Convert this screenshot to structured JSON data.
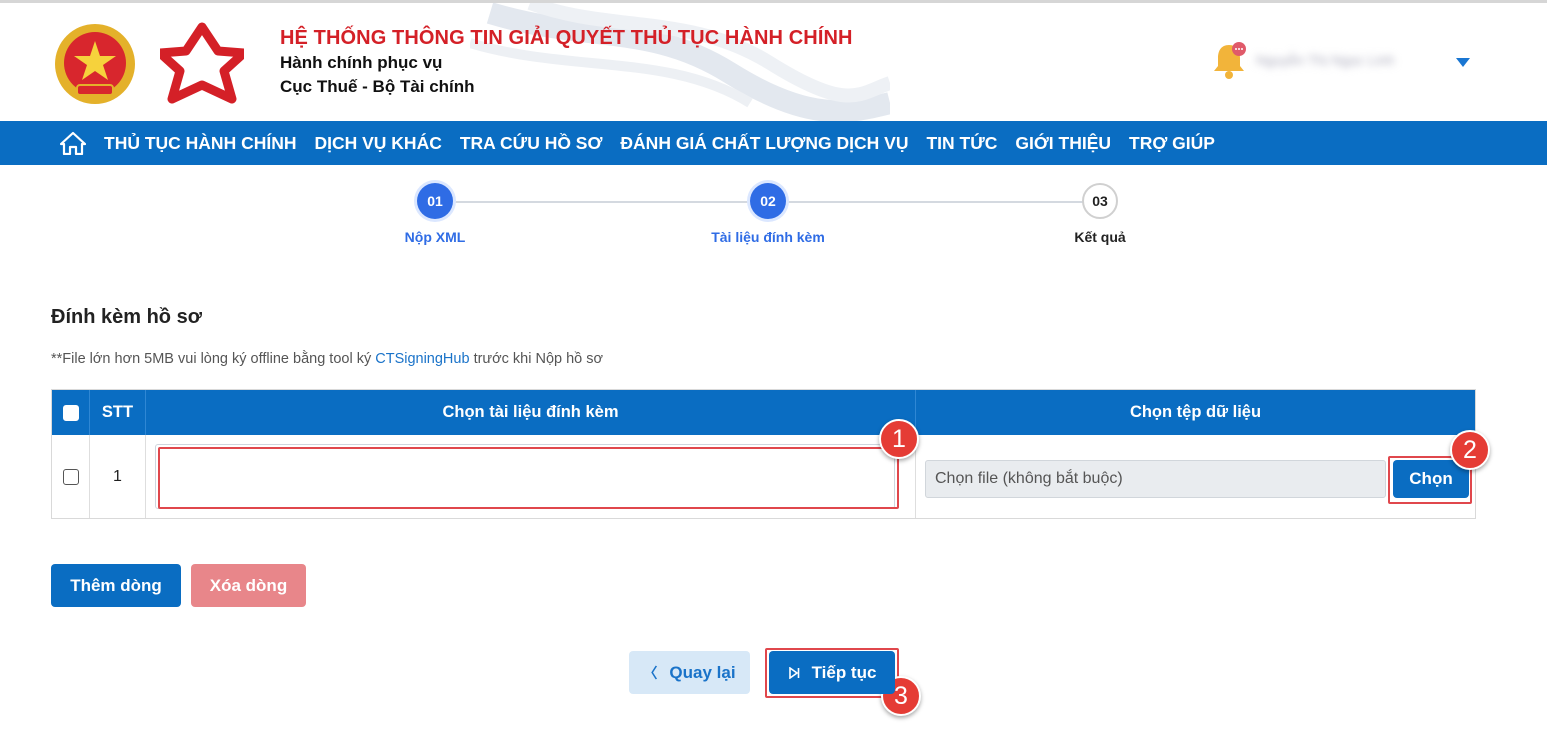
{
  "header": {
    "title": "HỆ THỐNG THÔNG TIN GIẢI QUYẾT THỦ TỤC HÀNH CHÍNH",
    "subtitle1": "Hành chính phục vụ",
    "subtitle2": "Cục Thuế - Bộ Tài chính",
    "user_name": "Nguyễn Thị Ngọc Linh"
  },
  "nav": {
    "items": [
      {
        "label": "THỦ TỤC HÀNH CHÍNH"
      },
      {
        "label": "DỊCH VỤ KHÁC"
      },
      {
        "label": "TRA CỨU HỒ SƠ"
      },
      {
        "label": "ĐÁNH GIÁ CHẤT LƯỢNG DỊCH VỤ"
      },
      {
        "label": "TIN TỨC"
      },
      {
        "label": "GIỚI THIỆU"
      },
      {
        "label": "TRỢ GIÚP"
      }
    ]
  },
  "stepper": {
    "steps": [
      {
        "number": "01",
        "label": "Nộp XML",
        "state": "active"
      },
      {
        "number": "02",
        "label": "Tài liệu đính kèm",
        "state": "active"
      },
      {
        "number": "03",
        "label": "Kết quả",
        "state": "pending"
      }
    ]
  },
  "section": {
    "title": "Đính kèm hồ sơ",
    "note_prefix": "**File lớn hơn 5MB vui lòng ký offline bằng tool ký ",
    "note_link": "CTSigningHub",
    "note_suffix": " trước khi Nộp hồ sơ"
  },
  "table": {
    "headers": {
      "stt": "STT",
      "document": "Chọn tài liệu đính kèm",
      "file": "Chọn tệp dữ liệu"
    },
    "rows": [
      {
        "stt": "1",
        "document": "",
        "file_placeholder": "Chọn file (không bắt buộc)",
        "choose_label": "Chọn"
      }
    ]
  },
  "actions": {
    "add_row": "Thêm dòng",
    "delete_row": "Xóa dòng",
    "back": "Quay lại",
    "next": "Tiếp tục"
  },
  "annotations": [
    "1",
    "2",
    "3"
  ],
  "colors": {
    "primary": "#0a6dc2",
    "title_red": "#d42027",
    "step_active": "#2f6ce5",
    "highlight": "#e0474c",
    "delete": "#e8868a"
  }
}
